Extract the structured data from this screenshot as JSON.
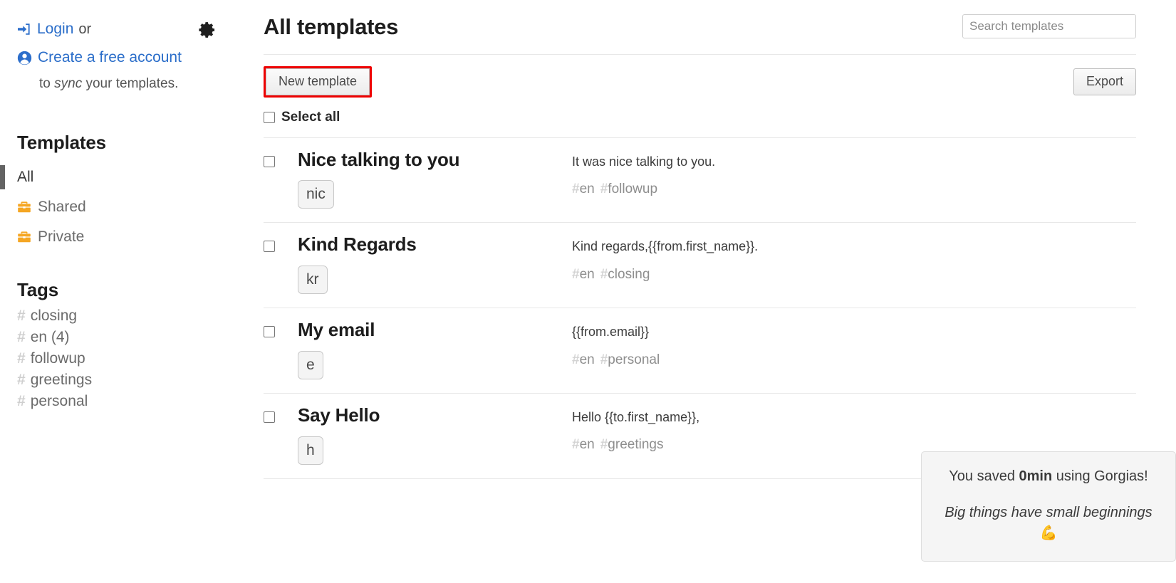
{
  "sidebar": {
    "account": {
      "login_icon": "sign-in-icon",
      "login_label": "Login",
      "or_label": "or",
      "create_icon": "user-circle-icon",
      "create_label": "Create a free account",
      "sync_prefix": "to ",
      "sync_emphasis": "sync",
      "sync_suffix": " your templates.",
      "settings_icon": "gear-icon"
    },
    "templates_heading": "Templates",
    "nav_items": [
      {
        "label": "All",
        "icon": "",
        "active": true
      },
      {
        "label": "Shared",
        "icon": "briefcase-icon",
        "active": false
      },
      {
        "label": "Private",
        "icon": "briefcase-icon",
        "active": false
      }
    ],
    "tags_heading": "Tags",
    "tags": [
      {
        "hash": "#",
        "label": "closing"
      },
      {
        "hash": "#",
        "label": "en (4)"
      },
      {
        "hash": "#",
        "label": "followup"
      },
      {
        "hash": "#",
        "label": "greetings"
      },
      {
        "hash": "#",
        "label": "personal"
      }
    ]
  },
  "main": {
    "title": "All templates",
    "search": {
      "value": "",
      "placeholder": "Search templates"
    },
    "new_template_label": "New template",
    "export_label": "Export",
    "select_all_label": "Select all",
    "templates": [
      {
        "name": "Nice talking to you",
        "shortcut": "nic",
        "body": "It was nice talking to you.",
        "tags": [
          "en",
          "followup"
        ]
      },
      {
        "name": "Kind Regards",
        "shortcut": "kr",
        "body": "Kind regards,{{from.first_name}}.",
        "tags": [
          "en",
          "closing"
        ]
      },
      {
        "name": "My email",
        "shortcut": "e",
        "body": "{{from.email}}",
        "tags": [
          "en",
          "personal"
        ]
      },
      {
        "name": "Say Hello",
        "shortcut": "h",
        "body": "Hello {{to.first_name}},",
        "tags": [
          "en",
          "greetings"
        ]
      }
    ]
  },
  "toast": {
    "line1_prefix": "You saved ",
    "line1_bold": "0min",
    "line1_suffix": " using Gorgias!",
    "line2": "Big things have small beginnings ",
    "line2_emoji": "💪"
  },
  "colors": {
    "link": "#2a6dc9",
    "highlight": "#ee0000",
    "briefcase": "#f5a623",
    "active_bar": "#636363"
  }
}
